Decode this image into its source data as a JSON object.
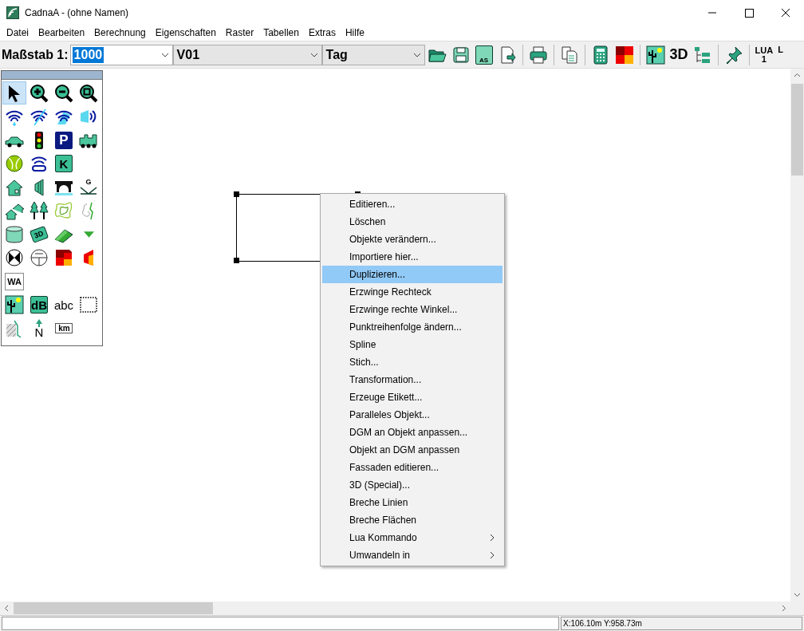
{
  "window": {
    "title": "CadnaA - (ohne Namen)"
  },
  "menu": [
    "Datei",
    "Bearbeiten",
    "Berechnung",
    "Eigenschaften",
    "Raster",
    "Tabellen",
    "Extras",
    "Hilfe"
  ],
  "toolbar": {
    "scale_label": "Maßstab 1:",
    "scale": {
      "value": "1000",
      "selected": true
    },
    "variant": {
      "value": "V01"
    },
    "period": {
      "value": "Tag"
    },
    "buttons": [
      {
        "kind": "open"
      },
      {
        "kind": "save"
      },
      {
        "kind": "save-as",
        "text": "AS"
      },
      {
        "kind": "export"
      },
      {
        "kind": "separator"
      },
      {
        "kind": "print"
      },
      {
        "kind": "separator"
      },
      {
        "kind": "copy"
      },
      {
        "kind": "separator"
      },
      {
        "kind": "calculator"
      },
      {
        "kind": "grid"
      },
      {
        "kind": "separator"
      },
      {
        "kind": "landscape"
      },
      {
        "kind": "text",
        "text": "3D"
      },
      {
        "kind": "tree"
      },
      {
        "kind": "separator"
      },
      {
        "kind": "pin"
      },
      {
        "kind": "separator"
      },
      {
        "kind": "lua",
        "text": "LUA",
        "sub": "1"
      },
      {
        "kind": "lua",
        "text": "L"
      }
    ]
  },
  "palette": [
    [
      {
        "kind": "arrow",
        "selected": true
      },
      {
        "kind": "zoom-in",
        "selected": false
      },
      {
        "kind": "zoom-out",
        "selected": false
      },
      {
        "kind": "zoom-fit",
        "selected": false
      }
    ],
    [
      {
        "kind": "wave",
        "selected": false
      },
      {
        "kind": "wave-line",
        "selected": false
      },
      {
        "kind": "wave-area",
        "selected": false
      },
      {
        "kind": "speaker",
        "selected": false
      }
    ],
    [
      {
        "kind": "car",
        "selected": false
      },
      {
        "kind": "traffic-light",
        "selected": false
      },
      {
        "kind": "sign",
        "text": "P",
        "selected": false
      },
      {
        "kind": "train",
        "selected": false
      }
    ],
    [
      {
        "kind": "ball",
        "selected": false
      },
      {
        "kind": "antenna",
        "selected": false
      },
      {
        "kind": "tile",
        "text": "K",
        "selected": false
      }
    ],
    [
      {
        "kind": "house",
        "selected": false
      },
      {
        "kind": "wall",
        "selected": false
      },
      {
        "kind": "bridge",
        "selected": false
      },
      {
        "kind": "ground",
        "text": "G",
        "selected": false
      }
    ],
    [
      {
        "kind": "houses",
        "selected": false
      },
      {
        "kind": "trees",
        "selected": false
      },
      {
        "kind": "contour",
        "selected": false
      },
      {
        "kind": "contour-line",
        "selected": false
      }
    ],
    [
      {
        "kind": "cylinder",
        "selected": false
      },
      {
        "kind": "tag",
        "text": "3D",
        "selected": false
      },
      {
        "kind": "wedge",
        "selected": false
      },
      {
        "kind": "triangle",
        "selected": false
      }
    ],
    [
      {
        "kind": "circle-cross",
        "selected": false
      },
      {
        "kind": "dial",
        "selected": false
      },
      {
        "kind": "grid",
        "selected": false
      },
      {
        "kind": "grid-facade",
        "selected": false
      }
    ],
    [
      {
        "kind": "document",
        "text": "WA",
        "selected": false
      }
    ],
    [
      {
        "kind": "landscape",
        "selected": false
      },
      {
        "kind": "tile",
        "text": "dB",
        "selected": false
      },
      {
        "kind": "plain-text",
        "text": "abc",
        "selected": false
      },
      {
        "kind": "dotted-rect",
        "selected": false
      }
    ],
    [
      {
        "kind": "hatch",
        "selected": false
      },
      {
        "kind": "north",
        "text": "N",
        "selected": false
      },
      {
        "kind": "km",
        "text": "km",
        "selected": false
      }
    ]
  ],
  "context_menu": [
    {
      "label": "Editieren...",
      "selected": false,
      "submenu": false
    },
    {
      "label": "Löschen",
      "selected": false,
      "submenu": false
    },
    {
      "label": "Objekte verändern...",
      "selected": false,
      "submenu": false
    },
    {
      "label": "Importiere hier...",
      "selected": false,
      "submenu": false
    },
    {
      "label": "Duplizieren...",
      "selected": true,
      "submenu": false
    },
    {
      "label": "Erzwinge Rechteck",
      "selected": false,
      "submenu": false
    },
    {
      "label": "Erzwinge rechte Winkel...",
      "selected": false,
      "submenu": false
    },
    {
      "label": "Punktreihenfolge ändern...",
      "selected": false,
      "submenu": false
    },
    {
      "label": "Spline",
      "selected": false,
      "submenu": false
    },
    {
      "label": "Stich...",
      "selected": false,
      "submenu": false
    },
    {
      "label": "Transformation...",
      "selected": false,
      "submenu": false
    },
    {
      "label": "Erzeuge Etikett...",
      "selected": false,
      "submenu": false
    },
    {
      "label": "Paralleles Objekt...",
      "selected": false,
      "submenu": false
    },
    {
      "label": "DGM an Objekt anpassen...",
      "selected": false,
      "submenu": false
    },
    {
      "label": "Objekt an DGM anpassen",
      "selected": false,
      "submenu": false
    },
    {
      "label": "Fassaden editieren...",
      "selected": false,
      "submenu": false
    },
    {
      "label": "3D (Special)...",
      "selected": false,
      "submenu": false
    },
    {
      "label": "Breche Linien",
      "selected": false,
      "submenu": false
    },
    {
      "label": "Breche Flächen",
      "selected": false,
      "submenu": false
    },
    {
      "label": "Lua Kommando",
      "selected": false,
      "submenu": true
    },
    {
      "label": "Umwandeln in",
      "selected": false,
      "submenu": true
    }
  ],
  "status_bar": {
    "coordinates": "X:106.10m Y:958.73m"
  }
}
